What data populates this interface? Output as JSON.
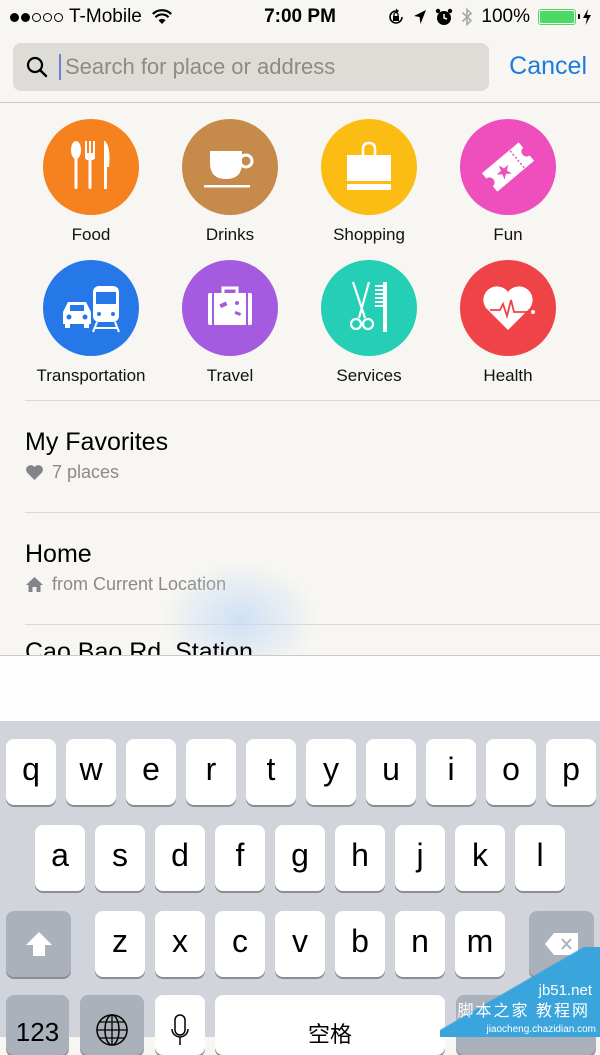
{
  "status_bar": {
    "signal_filled": 2,
    "signal_total": 5,
    "carrier": "T-Mobile",
    "time": "7:00 PM",
    "battery_percent": "100%",
    "battery_level": 1.0,
    "icons": [
      "wifi-icon",
      "rotation-lock-icon",
      "location-arrow-icon",
      "alarm-icon",
      "bluetooth-icon",
      "battery-icon",
      "charging-bolt-icon"
    ]
  },
  "search": {
    "placeholder": "Search for place or address",
    "value": "",
    "cancel_label": "Cancel"
  },
  "categories": [
    {
      "label": "Food",
      "icon": "utensils-icon",
      "color": "#f5821f"
    },
    {
      "label": "Drinks",
      "icon": "coffee-cup-icon",
      "color": "#c68a4a"
    },
    {
      "label": "Shopping",
      "icon": "shopping-bag-icon",
      "color": "#fbbd14"
    },
    {
      "label": "Fun",
      "icon": "ticket-icon",
      "color": "#ef4fbd"
    },
    {
      "label": "Transportation",
      "icon": "car-train-icon",
      "color": "#2678e8"
    },
    {
      "label": "Travel",
      "icon": "suitcase-icon",
      "color": "#a45be0"
    },
    {
      "label": "Services",
      "icon": "scissors-comb-icon",
      "color": "#25cfb5"
    },
    {
      "label": "Health",
      "icon": "heart-pulse-icon",
      "color": "#ef4347"
    }
  ],
  "list": [
    {
      "title": "My Favorites",
      "subtitle": "7 places",
      "icon": "heart-icon"
    },
    {
      "title": "Home",
      "subtitle": "from Current Location",
      "icon": "house-icon"
    },
    {
      "title": "Cao Bao Rd. Station",
      "subtitle": "",
      "icon": ""
    }
  ],
  "keyboard": {
    "row1": [
      "q",
      "w",
      "e",
      "r",
      "t",
      "y",
      "u",
      "i",
      "o",
      "p"
    ],
    "row2": [
      "a",
      "s",
      "d",
      "f",
      "g",
      "h",
      "j",
      "k",
      "l"
    ],
    "row3": [
      "z",
      "x",
      "c",
      "v",
      "b",
      "n",
      "m"
    ],
    "numbers_label": "123",
    "space_label": "空格"
  },
  "watermark": {
    "line1": "jb51.net",
    "line2": "脚本之家 教程网",
    "line3": "jiaocheng.chazidian.com"
  }
}
